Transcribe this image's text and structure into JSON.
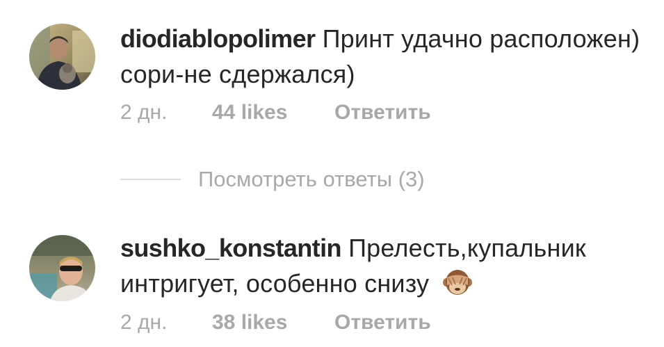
{
  "comments": [
    {
      "username": "diodiablopolimer",
      "text": "Принт удачно расположен) сори-не сдержался)",
      "time": "2 дн.",
      "likes": "44 likes",
      "reply_label": "Ответить",
      "avatar_icon": "user-avatar"
    },
    {
      "username": "sushko_konstantin",
      "text": "Прелесть,купальник интригует, особенно снизу",
      "emoji_icon": "see-no-evil-monkey-icon",
      "time": "2 дн.",
      "likes": "38 likes",
      "reply_label": "Ответить",
      "avatar_icon": "user-avatar"
    }
  ],
  "view_replies": {
    "label": "Посмотреть ответы (3)"
  }
}
